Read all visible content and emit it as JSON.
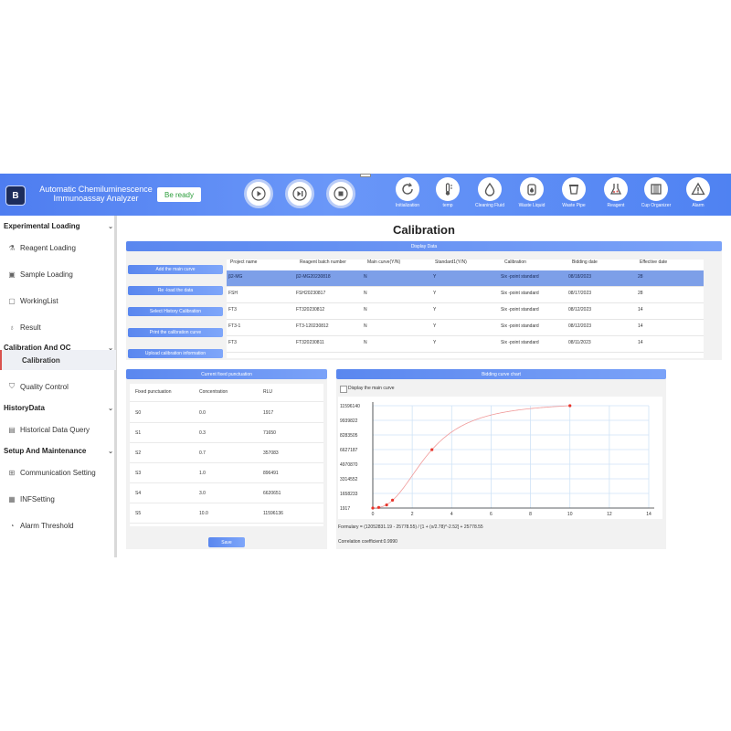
{
  "app": {
    "title_line1": "Automatic Chemiluminescence",
    "title_line2": "Immunoassay Analyzer",
    "logo_letter": "B",
    "status": "Be ready"
  },
  "toolbar": [
    {
      "label": "Initialization",
      "icon": "refresh-icon"
    },
    {
      "label": "temp",
      "icon": "thermometer-icon"
    },
    {
      "label": "Cleaning Fluid",
      "icon": "droplet-icon"
    },
    {
      "label": "Waste Liquid",
      "icon": "waste-liquid-icon"
    },
    {
      "label": "Waste Pipe",
      "icon": "waste-pipe-icon"
    },
    {
      "label": "Reagent",
      "icon": "reagent-icon"
    },
    {
      "label": "Cup Organizer",
      "icon": "cup-organizer-icon"
    },
    {
      "label": "Alarm",
      "icon": "alarm-icon"
    }
  ],
  "sidebar": {
    "groups": [
      {
        "label": "Experimental Loading",
        "items": [
          "Reagent Loading",
          "Sample Loading",
          "WorkingList",
          "Result"
        ]
      },
      {
        "label": "Calibration And QC",
        "items": [
          "Calibration",
          "Quality Control"
        ]
      },
      {
        "label": "HistoryData",
        "items": [
          "Historical Data Query"
        ]
      },
      {
        "label": "Setup And Maintenance",
        "items": [
          "Communication Setting",
          "INFSetting",
          "Alarm Threshold"
        ]
      }
    ]
  },
  "page": {
    "title": "Calibration",
    "display_data_label": "Display Data",
    "actions": [
      "Add the main curve",
      "Re -load the data",
      "Select History Calibration",
      "Print the calibration curve",
      "Upload calibration information"
    ]
  },
  "table": {
    "headers": [
      "Project name",
      "Reagent batch number",
      "Main curve(Y/N)",
      "Standard1(Y/N)",
      "Calibration",
      "Bidding date",
      "Effective date"
    ],
    "rows": [
      [
        "β2-MG",
        "β2-MG20230818",
        "N",
        "Y",
        "Six -point standard",
        "08/18/2023",
        "28"
      ],
      [
        "FSH",
        "FSH20230817",
        "N",
        "Y",
        "Six -point standard",
        "08/17/2023",
        "28"
      ],
      [
        "FT3",
        "FT320230812",
        "N",
        "Y",
        "Six -point standard",
        "08/12/2023",
        "14"
      ],
      [
        "FT3-1",
        "FT3-120230812",
        "N",
        "Y",
        "Six -point standard",
        "08/12/2023",
        "14"
      ],
      [
        "FT3",
        "FT320230811",
        "N",
        "Y",
        "Six -point standard",
        "08/11/2023",
        "14"
      ]
    ]
  },
  "fixed_points": {
    "title": "Current fixed punctuation",
    "headers": [
      "Fixed punctuation",
      "Concentration",
      "RLU"
    ],
    "rows": [
      [
        "S0",
        "0.0",
        "1917"
      ],
      [
        "S1",
        "0.3",
        "71650"
      ],
      [
        "S2",
        "0.7",
        "357083"
      ],
      [
        "S3",
        "1.0",
        "896491"
      ],
      [
        "S4",
        "3.0",
        "6620651"
      ],
      [
        "S5",
        "10.0",
        "11596136"
      ]
    ],
    "save_label": "Save"
  },
  "curve_panel": {
    "title": "Bidding curve chart",
    "checkbox_label": "Display the main curve",
    "formula": "Formulary = (12052831.19 - 25778.55) / [1 + (x/2.78)^-2.52] + 25778.55",
    "correlation": "Correlation coefficient:0.9990"
  },
  "chart_data": {
    "type": "scatter",
    "x_ticks": [
      0,
      2,
      4,
      6,
      8,
      10,
      12,
      14
    ],
    "y_ticks": [
      1917,
      1658233,
      3314552,
      4970870,
      6627187,
      8283505,
      9939822,
      11596140
    ],
    "xlim": [
      0,
      14
    ],
    "ylim": [
      1917,
      11596140
    ],
    "points": [
      [
        0,
        1917
      ],
      [
        0.3,
        71650
      ],
      [
        0.7,
        357083
      ],
      [
        1.0,
        896491
      ],
      [
        3.0,
        6620651
      ],
      [
        10.0,
        11596136
      ]
    ],
    "curve": {
      "a": 12052831.19,
      "d": 25778.55,
      "c": 2.78,
      "b": 2.52
    },
    "grid": true,
    "point_color": "#e8352b",
    "curve_color": "#f09a9a"
  }
}
